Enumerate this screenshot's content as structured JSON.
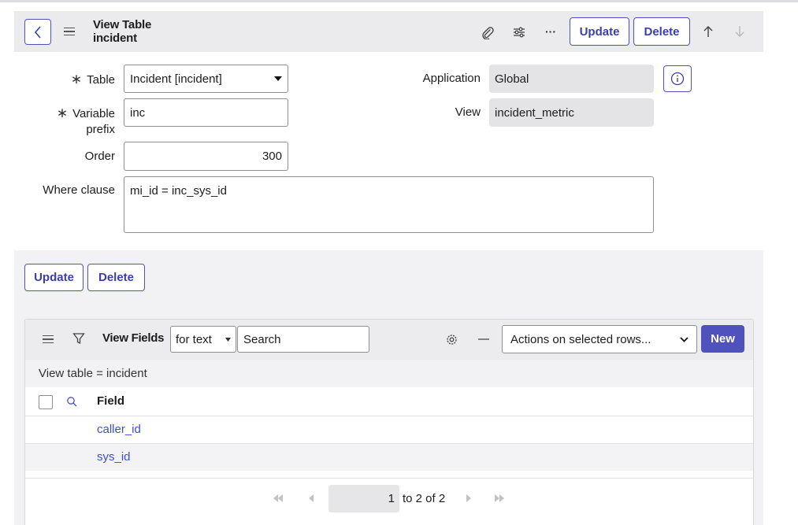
{
  "header": {
    "title_line1": "View Table",
    "title_line2": "incident",
    "update_label": "Update",
    "delete_label": "Delete",
    "more_label": "···"
  },
  "form": {
    "table_label": "Table",
    "table_value": "Incident [incident]",
    "prefix_label_line1": "Variable",
    "prefix_label_line2": "prefix",
    "prefix_value": "inc",
    "order_label": "Order",
    "order_value": "300",
    "where_label": "Where clause",
    "where_value": "mi_id = inc_sys_id",
    "application_label": "Application",
    "application_value": "Global",
    "view_label": "View",
    "view_value": "incident_metric",
    "required_mark": "∗"
  },
  "bottom_buttons": {
    "update_label": "Update",
    "delete_label": "Delete"
  },
  "related_list": {
    "title": "View Fields",
    "search_field_select": "for text",
    "search_placeholder": "Search",
    "actions_select": "Actions on selected rows...",
    "new_label": "New",
    "filter_text": "View table = incident",
    "column_header": "Field",
    "rows": [
      "caller_id",
      "sys_id"
    ],
    "pager_current": "1",
    "pager_text": "to 2 of 2"
  },
  "colors": {
    "accent": "#4f52bd",
    "link": "#3c4fd3",
    "header_bg": "#ebebed"
  }
}
